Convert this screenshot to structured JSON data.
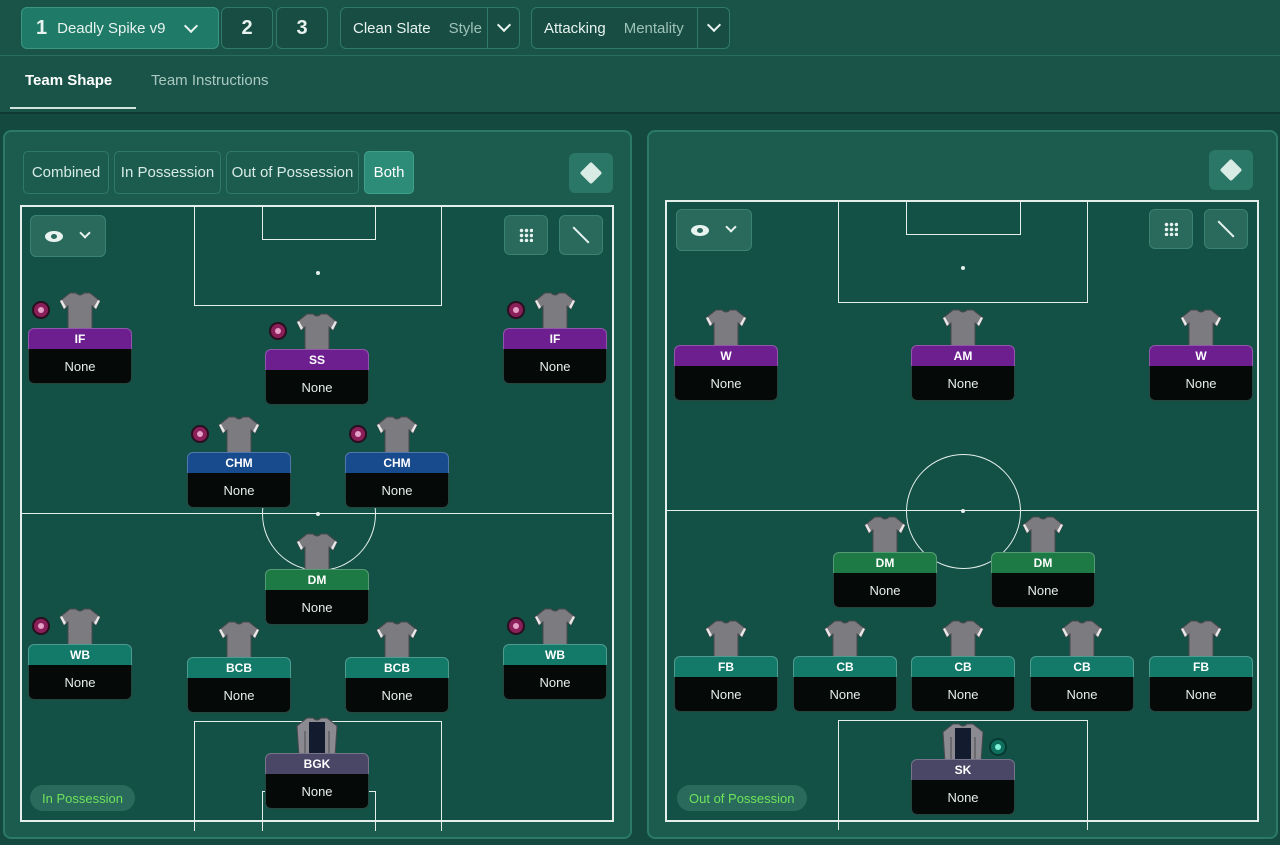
{
  "header": {
    "tactic_number": "1",
    "tactic_name": "Deadly Spike v9",
    "tab2": "2",
    "tab3": "3",
    "style_value": "Clean Slate",
    "style_label": "Style",
    "mentality_value": "Attacking",
    "mentality_label": "Mentality",
    "subtabs": [
      "Team Shape",
      "Team Instructions"
    ]
  },
  "left_panel": {
    "segments": [
      "Combined",
      "In Possession",
      "Out of Possession",
      "Both"
    ],
    "badge": "In Possession",
    "players": [
      {
        "role": "IF",
        "duty": "None"
      },
      {
        "role": "SS",
        "duty": "None"
      },
      {
        "role": "IF",
        "duty": "None"
      },
      {
        "role": "CHM",
        "duty": "None"
      },
      {
        "role": "CHM",
        "duty": "None"
      },
      {
        "role": "DM",
        "duty": "None"
      },
      {
        "role": "WB",
        "duty": "None"
      },
      {
        "role": "BCB",
        "duty": "None"
      },
      {
        "role": "BCB",
        "duty": "None"
      },
      {
        "role": "WB",
        "duty": "None"
      },
      {
        "role": "BGK",
        "duty": "None"
      }
    ]
  },
  "right_panel": {
    "badge": "Out of Possession",
    "players": [
      {
        "role": "W",
        "duty": "None"
      },
      {
        "role": "AM",
        "duty": "None"
      },
      {
        "role": "W",
        "duty": "None"
      },
      {
        "role": "DM",
        "duty": "None"
      },
      {
        "role": "DM",
        "duty": "None"
      },
      {
        "role": "FB",
        "duty": "None"
      },
      {
        "role": "CB",
        "duty": "None"
      },
      {
        "role": "CB",
        "duty": "None"
      },
      {
        "role": "CB",
        "duty": "None"
      },
      {
        "role": "FB",
        "duty": "None"
      },
      {
        "role": "SK",
        "duty": "None"
      }
    ]
  },
  "colors": {
    "attack_role": "#6d1f8f",
    "midfield_role": "#184a8e",
    "dm_role": "#1e7a45",
    "defence_role": "#137a6a",
    "keeper_role": "#4a4666",
    "active_segment": "#2d8c78",
    "badge_text": "#6ee35a"
  }
}
